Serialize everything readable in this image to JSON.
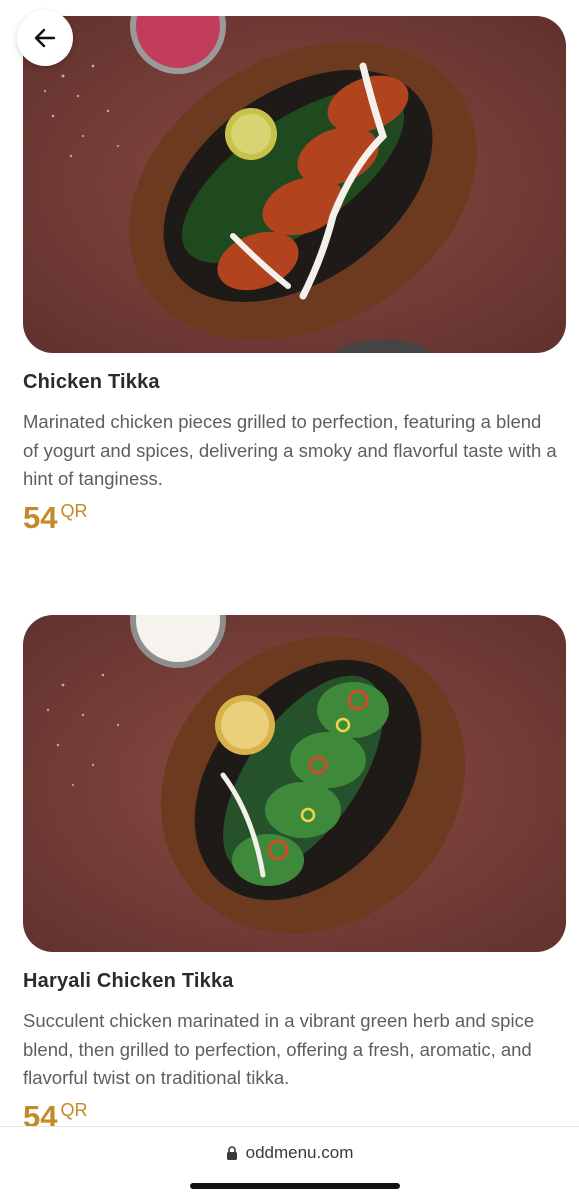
{
  "header": {
    "back_icon": "arrow-left-icon"
  },
  "menu_items": [
    {
      "name": "Chicken Tikka",
      "description": "Marinated chicken pieces grilled to perfection, featuring a blend of yogurt and spices, delivering a smoky and flavorful taste with a hint of tanginess.",
      "price": "54",
      "currency": "QR"
    },
    {
      "name": "Haryali Chicken Tikka",
      "description": "Succulent chicken marinated in a vibrant green herb and spice blend, then grilled to perfection, offering a fresh, aromatic, and flavorful twist on traditional tikka.",
      "price": "54",
      "currency": "QR"
    }
  ],
  "browser": {
    "url": "oddmenu.com",
    "lock_icon": "lock-icon"
  },
  "colors": {
    "price": "#c48a28",
    "title": "#2b2b2b",
    "description": "#5e5e5e",
    "image_background": "#7a3f3a"
  }
}
